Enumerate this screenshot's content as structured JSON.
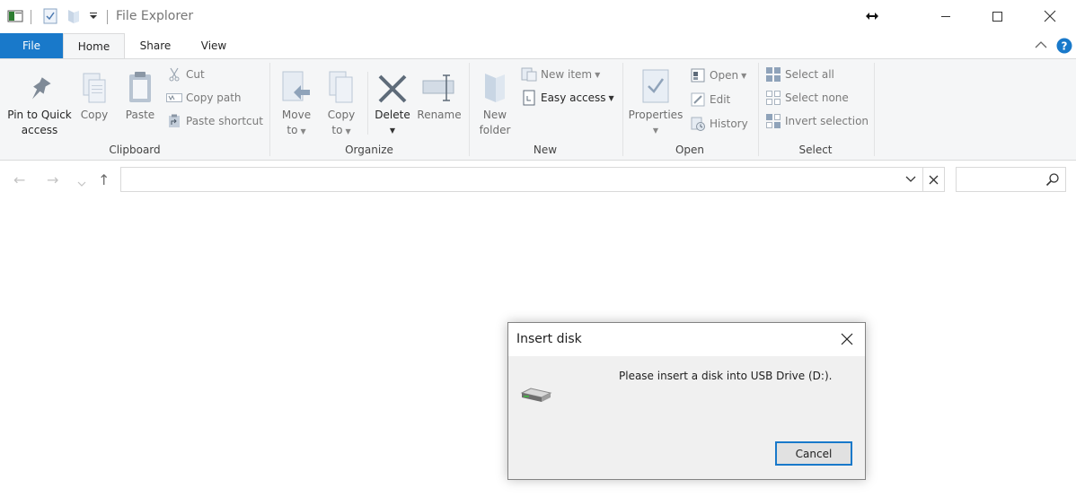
{
  "window": {
    "title": "File Explorer"
  },
  "tabs": {
    "file": "File",
    "home": "Home",
    "share": "Share",
    "view": "View"
  },
  "ribbon": {
    "clipboard": {
      "label": "Clipboard",
      "pin_line1": "Pin to Quick",
      "pin_line2": "access",
      "copy": "Copy",
      "paste": "Paste",
      "cut": "Cut",
      "copy_path": "Copy path",
      "paste_shortcut": "Paste shortcut"
    },
    "organize": {
      "label": "Organize",
      "move_line1": "Move",
      "move_line2": "to",
      "copy_line1": "Copy",
      "copy_line2": "to",
      "delete": "Delete",
      "rename": "Rename"
    },
    "new": {
      "label": "New",
      "new_folder_line1": "New",
      "new_folder_line2": "folder",
      "new_item": "New item",
      "easy_access": "Easy access"
    },
    "open": {
      "label": "Open",
      "properties": "Properties",
      "open": "Open",
      "edit": "Edit",
      "history": "History"
    },
    "select": {
      "label": "Select",
      "select_all": "Select all",
      "select_none": "Select none",
      "invert_selection": "Invert selection"
    }
  },
  "address": {
    "value": ""
  },
  "search": {
    "value": ""
  },
  "dialog": {
    "title": "Insert disk",
    "message": "Please insert a disk into USB Drive (D:).",
    "cancel": "Cancel"
  },
  "colors": {
    "accent": "#1979ca",
    "ribbon_bg": "#f5f6f7",
    "dialog_bg": "#f0f0f0"
  }
}
